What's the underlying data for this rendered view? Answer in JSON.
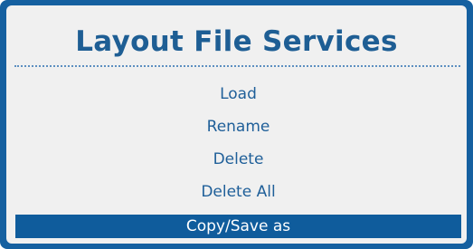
{
  "dialog": {
    "title": "Layout File Services",
    "items": [
      {
        "label": "Load",
        "selected": false
      },
      {
        "label": "Rename",
        "selected": false
      },
      {
        "label": "Delete",
        "selected": false
      },
      {
        "label": "Delete All",
        "selected": false
      },
      {
        "label": "Copy/Save as",
        "selected": true
      }
    ]
  },
  "colors": {
    "frame": "#1560a0",
    "panel_background": "#f0f0f0",
    "text": "#1f5f99",
    "selection_background": "#0f5c9c",
    "selection_text": "#ffffff"
  }
}
